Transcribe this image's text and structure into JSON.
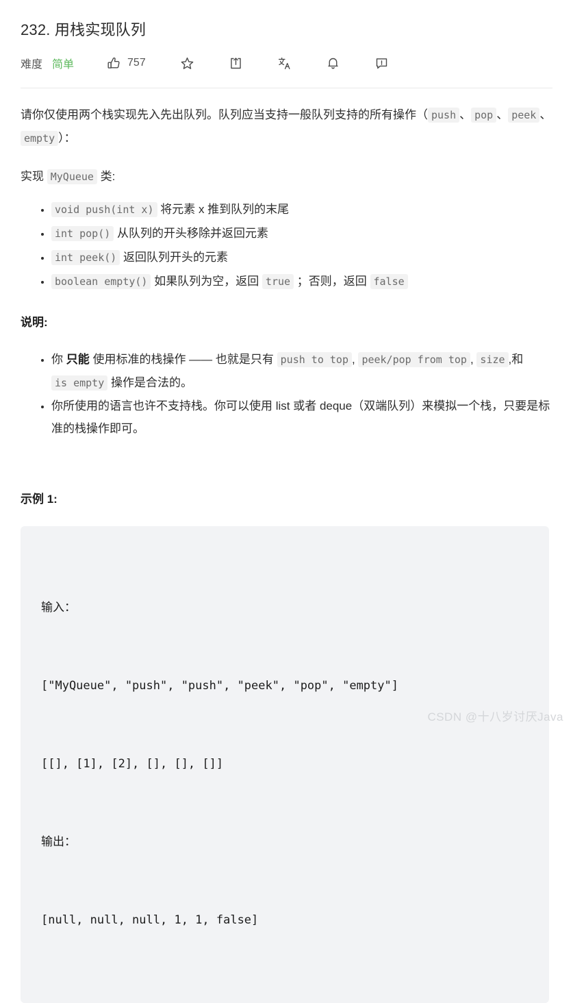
{
  "problem": {
    "title": "232. 用栈实现队列",
    "difficulty_label": "难度",
    "difficulty_value": "简单",
    "difficulty_color": "#5eb95e",
    "like_count": "757",
    "icons": {
      "like": "thumbs-up-icon",
      "favorite": "star-icon",
      "share": "share-icon",
      "translate": "translate-icon",
      "notify": "bell-icon",
      "feedback": "feedback-icon"
    }
  },
  "description": {
    "p1_a": "请你仅使用两个栈实现先入先出队列。队列应当支持一般队列支持的所有操作（",
    "p1_code1": "push",
    "p1_sep1": "、",
    "p1_code2": "pop",
    "p1_sep2": "、",
    "p1_code3": "peek",
    "p1_sep3": "、",
    "p1_code4": "empty",
    "p1_b": "）：",
    "p2_a": "实现 ",
    "p2_code": "MyQueue",
    "p2_b": " 类:",
    "methods": [
      {
        "code": "void push(int x)",
        "text": " 将元素 x 推到队列的末尾"
      },
      {
        "code": "int pop()",
        "text": " 从队列的开头移除并返回元素"
      },
      {
        "code": "int peek()",
        "text": " 返回队列开头的元素"
      }
    ],
    "method4": {
      "code": "boolean empty()",
      "text_a": " 如果队列为空，返回 ",
      "code_true": "true",
      "text_b": " ；否则，返回 ",
      "code_false": "false"
    }
  },
  "notes": {
    "heading": "说明:",
    "item1": {
      "a": "你 ",
      "strong": "只能",
      "b": " 使用标准的栈操作 —— 也就是只有 ",
      "code1": "push to top",
      "c": ", ",
      "code2": "peek/pop from top",
      "d": ", ",
      "code3": "size",
      "e": ",和 ",
      "code4": "is empty",
      "f": " 操作是合法的。"
    },
    "item2": "你所使用的语言也许不支持栈。你可以使用 list 或者 deque（双端队列）来模拟一个栈，只要是标准的栈操作即可。"
  },
  "example": {
    "heading": "示例 1:",
    "lines": [
      "输入：",
      "[\"MyQueue\", \"push\", \"push\", \"peek\", \"pop\", \"empty\"]",
      "[[], [1], [2], [], [], []]",
      "输出：",
      "[null, null, null, 1, 1, false]"
    ]
  },
  "watermark": "CSDN @十八岁讨厌Java"
}
